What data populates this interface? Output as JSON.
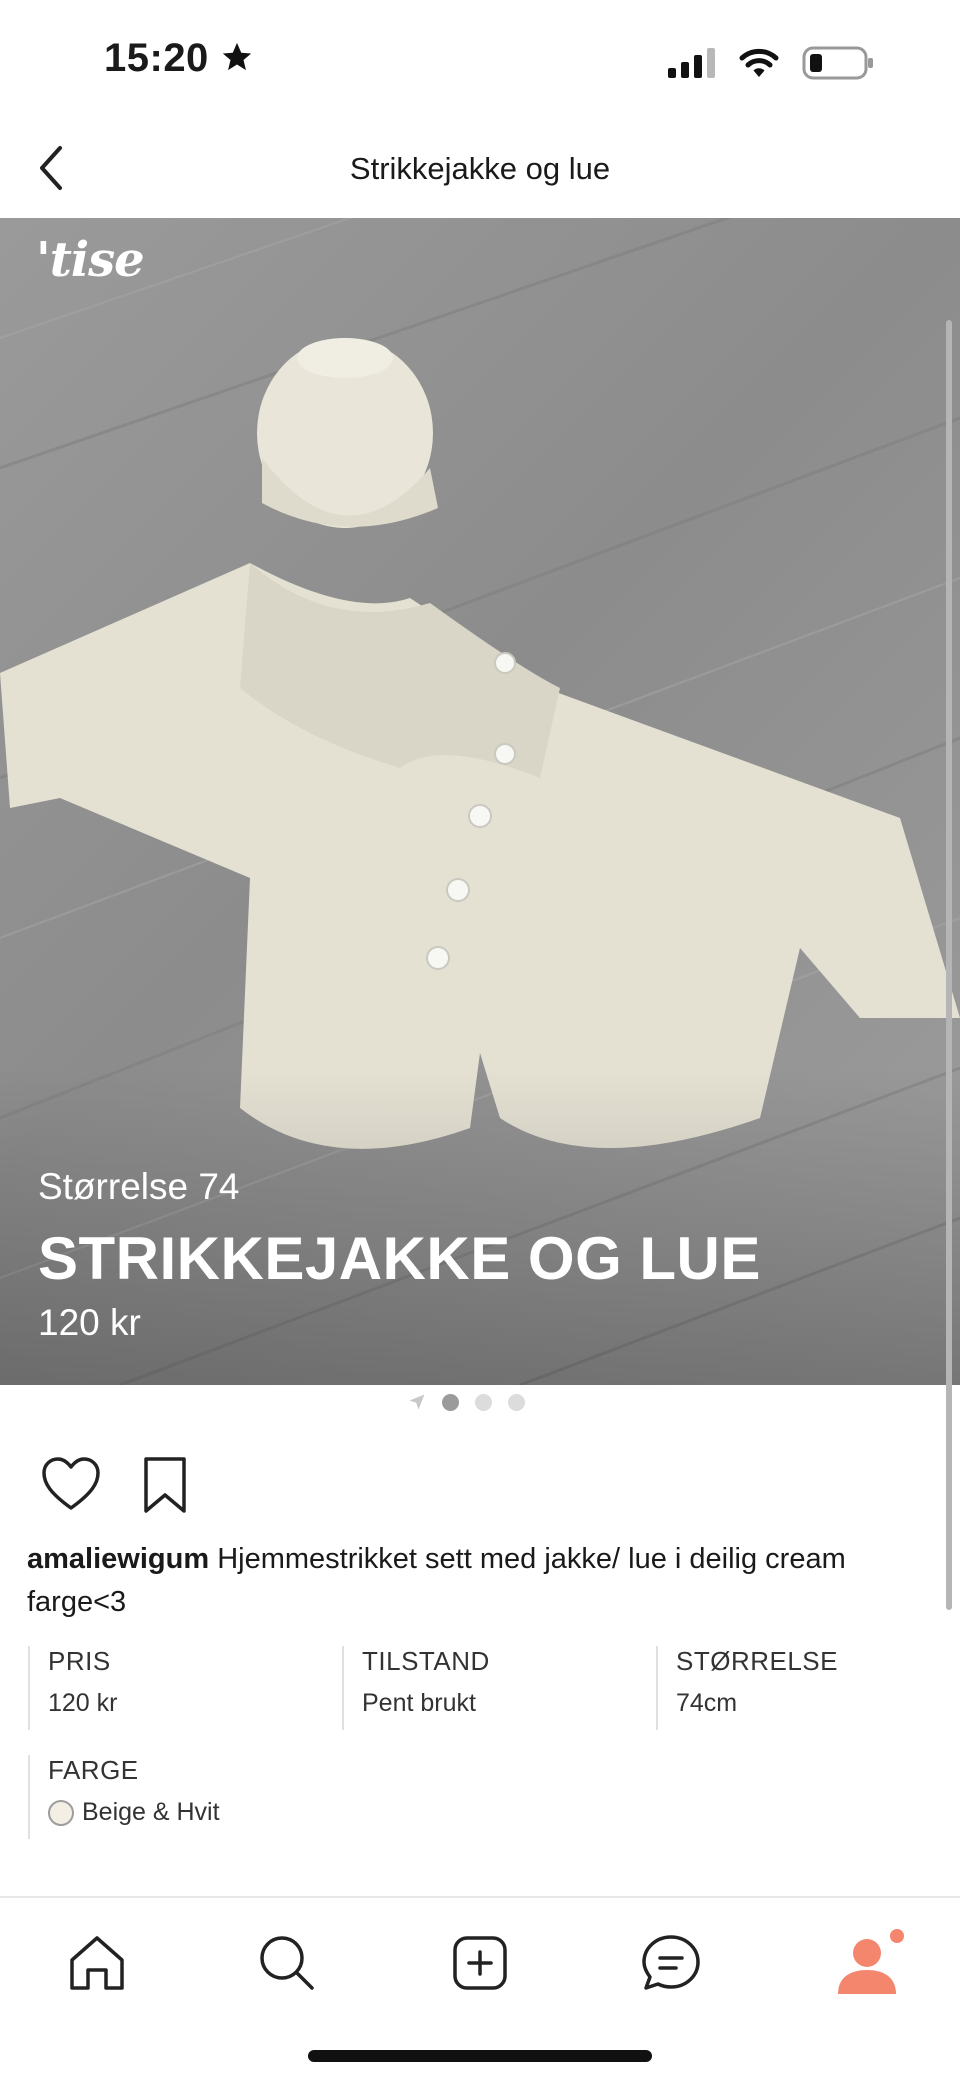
{
  "status_bar": {
    "time": "15:20"
  },
  "nav": {
    "title": "Strikkejakke og lue"
  },
  "listing": {
    "logo": "'tise",
    "size_line": "Størrelse 74",
    "title": "STRIKKEJAKKE OG LUE",
    "price": "120 kr",
    "pager": {
      "total": 3,
      "active": 1
    }
  },
  "description": {
    "username": "amaliewigum",
    "text": "Hjemmestrikket sett med jakke/ lue i deilig cream farge<3"
  },
  "attributes": {
    "pris": {
      "label": "PRIS",
      "value": "120 kr"
    },
    "tilstand": {
      "label": "TILSTAND",
      "value": "Pent brukt"
    },
    "storrelse": {
      "label": "STØRRELSE",
      "value": "74cm"
    },
    "farge": {
      "label": "FARGE",
      "value": "Beige & Hvit",
      "swatch_color": "#f3efe4"
    }
  },
  "tabs": [
    "home-icon",
    "search-icon",
    "add-icon",
    "messages-icon",
    "profile-icon"
  ],
  "colors": {
    "accent": "#f5866e",
    "text": "#1a1a1a"
  }
}
